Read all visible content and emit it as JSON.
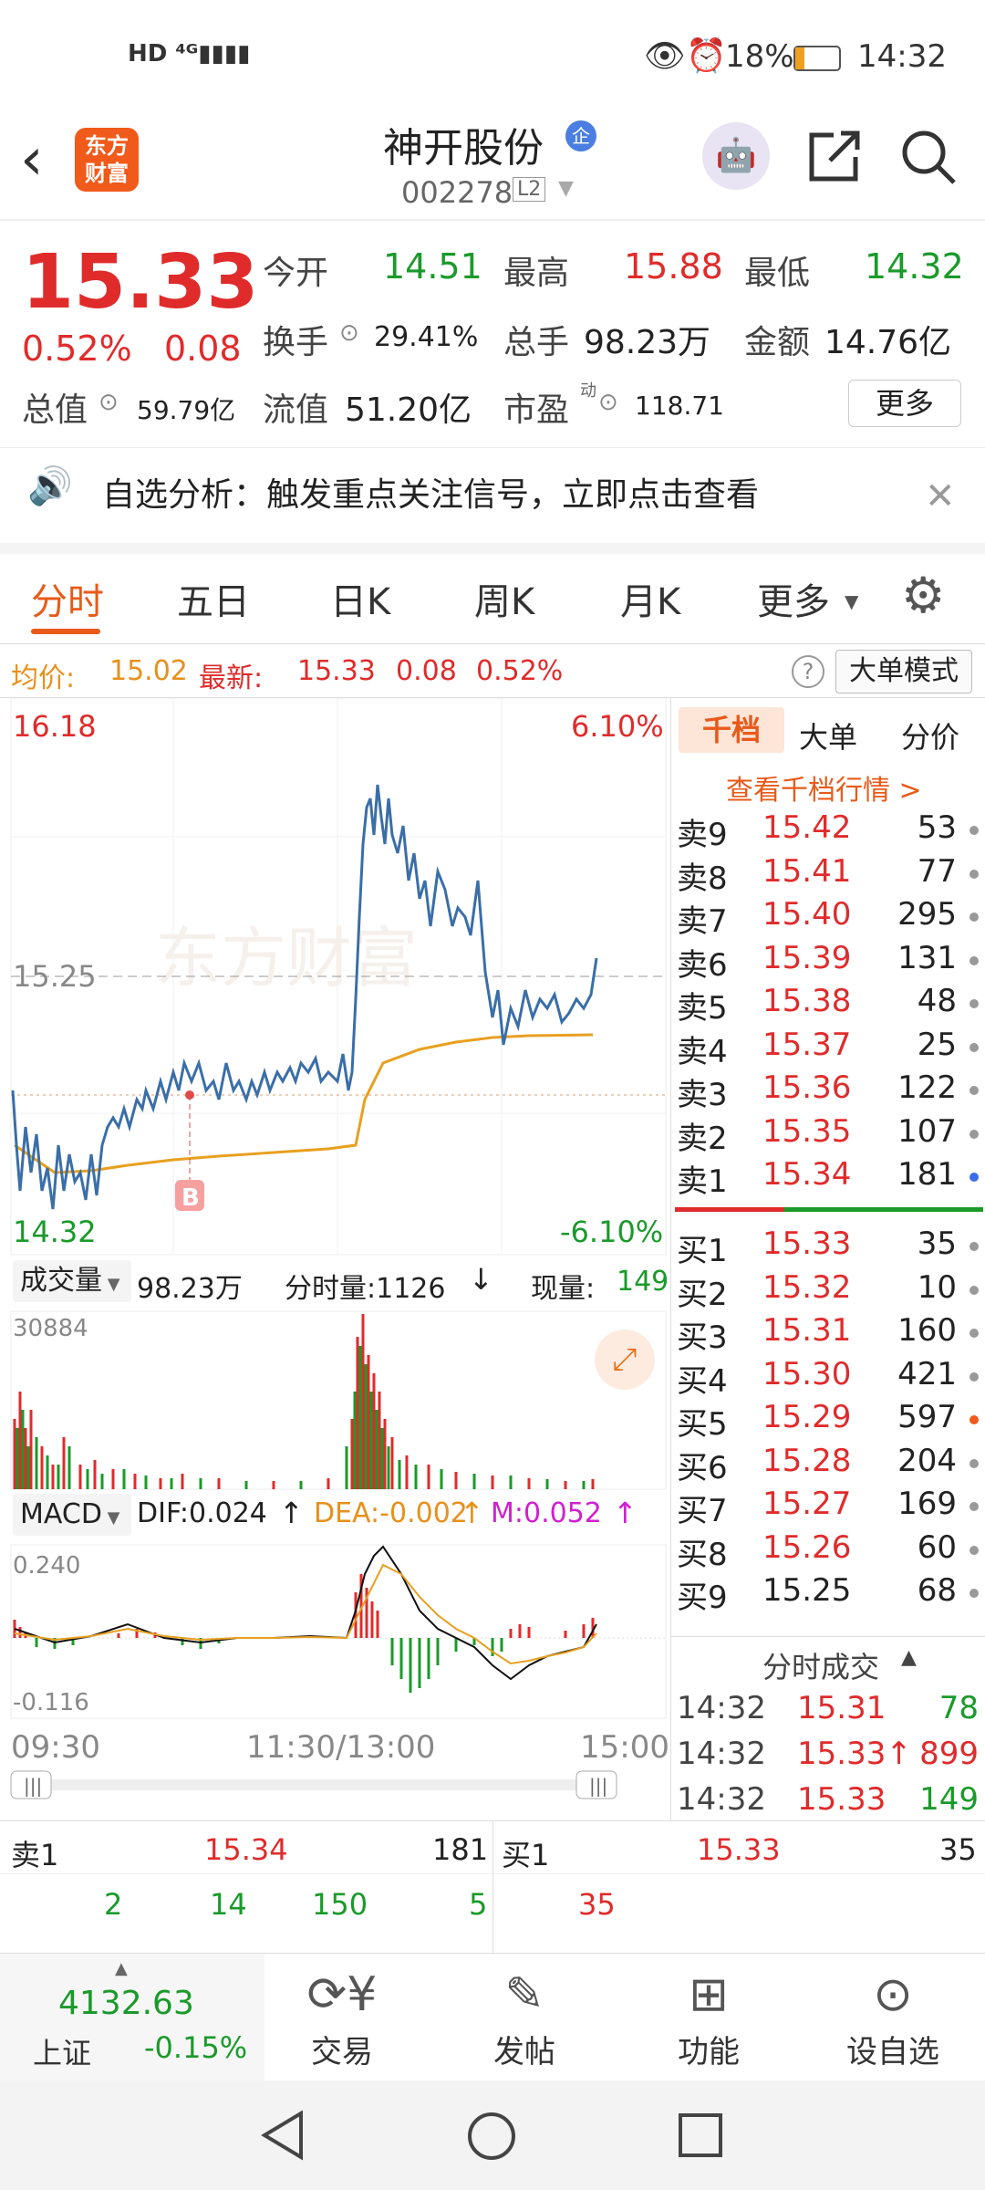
{
  "status": {
    "left_icons": "HD 4G signal",
    "battery": "18%",
    "time": "14:32"
  },
  "nav": {
    "logo": "东方\n财富",
    "stock_name": "神开股份",
    "badge": "企",
    "code": "002278",
    "level": "L2"
  },
  "quote": {
    "price": "15.33",
    "pct": "0.52%",
    "change": "0.08",
    "open_label": "今开",
    "open": "14.51",
    "high_label": "最高",
    "high": "15.88",
    "low_label": "最低",
    "low": "14.32",
    "turnover_label": "换手",
    "turnover": "29.41%",
    "volume_label": "总手",
    "volume": "98.23万",
    "amount_label": "金额",
    "amount": "14.76亿",
    "mktcap_label": "总值",
    "mktcap": "59.79亿",
    "float_label": "流值",
    "float": "51.20亿",
    "pe_label": "市盈",
    "pe_sup": "动",
    "pe": "118.71",
    "more": "更多"
  },
  "banner": {
    "text": "自选分析：触发重点关注信号，立即点击查看"
  },
  "tabs": [
    "分时",
    "五日",
    "日K",
    "周K",
    "月K",
    "更多"
  ],
  "info": {
    "avg_label": "均价:",
    "avg": "15.02",
    "latest_label": "最新:",
    "latest": "15.33",
    "chg": "0.08",
    "pct": "0.52%",
    "mode": "大单模式"
  },
  "chart": {
    "ymax": "16.18",
    "ymin": "14.32",
    "pmax": "6.10%",
    "pmin": "-6.10%",
    "ref": "15.25",
    "watermark": "东方财富",
    "marker": "B"
  },
  "volume": {
    "label": "成交量",
    "total": "98.23万",
    "tick_label": "分时量:1126",
    "tick_arrow": "↓",
    "now_label": "现量:",
    "now": "149",
    "max": "30884"
  },
  "macd": {
    "label": "MACD",
    "dif": "DIF:0.024",
    "dea": "DEA:-0.002",
    "m": "M:0.052",
    "arrow": "↑",
    "top": "0.240",
    "bottom": "-0.116"
  },
  "times": [
    "09:30",
    "11:30/13:00",
    "15:00"
  ],
  "ob": {
    "tabs": [
      "千档",
      "大单",
      "分价"
    ],
    "link": "查看千档行情 >",
    "asks": [
      [
        "卖9",
        "15.42",
        "53"
      ],
      [
        "卖8",
        "15.41",
        "77"
      ],
      [
        "卖7",
        "15.40",
        "295"
      ],
      [
        "卖6",
        "15.39",
        "131"
      ],
      [
        "卖5",
        "15.38",
        "48"
      ],
      [
        "卖4",
        "15.37",
        "25"
      ],
      [
        "卖3",
        "15.36",
        "122"
      ],
      [
        "卖2",
        "15.35",
        "107"
      ],
      [
        "卖1",
        "15.34",
        "181"
      ]
    ],
    "bids": [
      [
        "买1",
        "15.33",
        "35"
      ],
      [
        "买2",
        "15.32",
        "10"
      ],
      [
        "买3",
        "15.31",
        "160"
      ],
      [
        "买4",
        "15.30",
        "421"
      ],
      [
        "买5",
        "15.29",
        "597"
      ],
      [
        "买6",
        "15.28",
        "204"
      ],
      [
        "买7",
        "15.27",
        "169"
      ],
      [
        "买8",
        "15.26",
        "60"
      ],
      [
        "买9",
        "15.25",
        "68"
      ]
    ],
    "trades_title": "分时成交",
    "trades": [
      [
        "14:32",
        "15.31",
        "78"
      ],
      [
        "14:32",
        "15.33↑",
        "899"
      ],
      [
        "14:32",
        "15.33",
        "149"
      ]
    ]
  },
  "bottom": {
    "ask_label": "卖1",
    "ask_price": "15.34",
    "ask_vol": "181",
    "bid_label": "买1",
    "bid_price": "15.33",
    "bid_vol": "35",
    "ask_queue": [
      "2",
      "14",
      "150",
      "5"
    ],
    "bid_queue": [
      "35"
    ]
  },
  "toolbar": {
    "index_value": "4132.63",
    "index_name": "上证",
    "index_pct": "-0.15%",
    "items": [
      "交易",
      "发帖",
      "功能",
      "设自选"
    ]
  },
  "colors": {
    "up": "#e02b2b",
    "down": "#1a9a2a",
    "accent": "#e8901a",
    "brand": "#f05a1a"
  }
}
